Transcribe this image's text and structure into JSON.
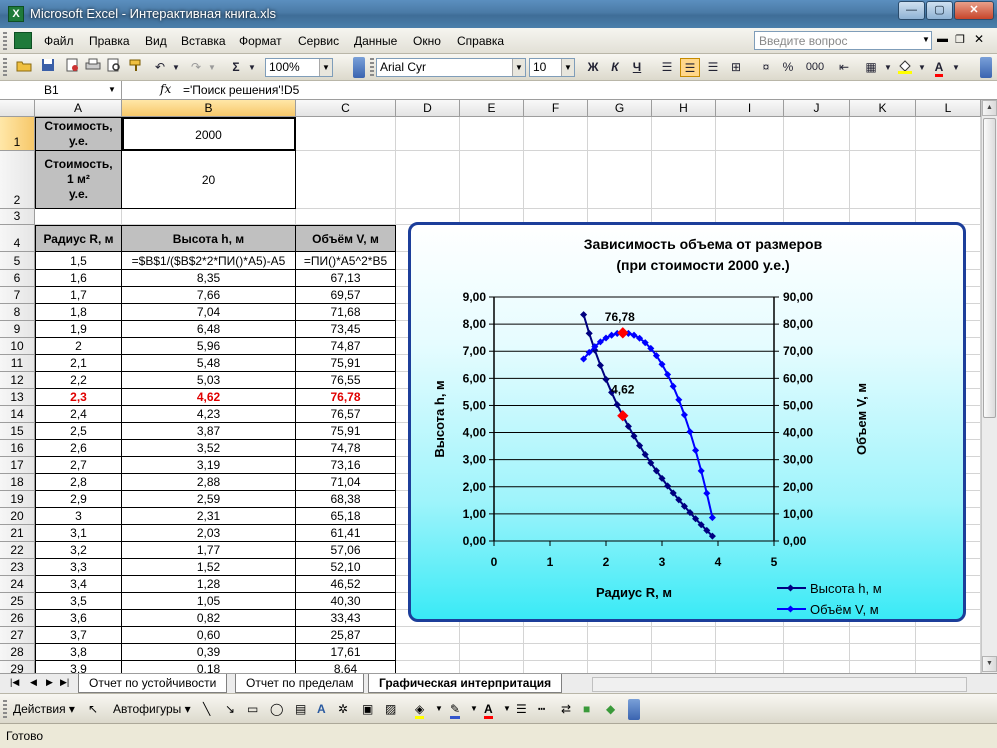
{
  "window": {
    "title": "Microsoft Excel - Интерактивная книга.xls",
    "app_icon": "X",
    "min": "—",
    "max": "▢",
    "close": "✕"
  },
  "menu": {
    "items": [
      "Файл",
      "Правка",
      "Вид",
      "Вставка",
      "Формат",
      "Сервис",
      "Данные",
      "Окно",
      "Справка"
    ],
    "help_placeholder": "Введите вопрос"
  },
  "toolbar": {
    "zoom": "100%",
    "font_name": "Arial Cyr",
    "font_size": "10",
    "bold": "Ж",
    "italic": "К",
    "underline": "Ч",
    "sum": "Σ",
    "percent": "%",
    "thousands": "000"
  },
  "formula_bar": {
    "name_box": "B1",
    "fx": "fx",
    "formula": "='Поиск решения'!D5"
  },
  "columns": [
    "A",
    "B",
    "C",
    "D",
    "E",
    "F",
    "G",
    "H",
    "I",
    "J",
    "K",
    "L"
  ],
  "rows": [
    "1",
    "2",
    "3",
    "4",
    "5",
    "6",
    "7",
    "8",
    "9",
    "10",
    "11",
    "12",
    "13",
    "14",
    "15",
    "16",
    "17",
    "18",
    "19",
    "20",
    "21",
    "22",
    "23",
    "24",
    "25",
    "26",
    "27",
    "28",
    "29"
  ],
  "sheet": {
    "a1": "Стоимость,\nу.е.",
    "b1": "2000",
    "a2": "Стоимость,\n1 м²\nу.е.",
    "b2": "20",
    "headers": [
      "Радиус R, м",
      "Высота h, м",
      "Объём V, м"
    ],
    "table": [
      [
        "1,5",
        "=$B$1/($B$2*2*ПИ()*A5)-A5",
        "=ПИ()*A5^2*B5"
      ],
      [
        "1,6",
        "8,35",
        "67,13"
      ],
      [
        "1,7",
        "7,66",
        "69,57"
      ],
      [
        "1,8",
        "7,04",
        "71,68"
      ],
      [
        "1,9",
        "6,48",
        "73,45"
      ],
      [
        "2",
        "5,96",
        "74,87"
      ],
      [
        "2,1",
        "5,48",
        "75,91"
      ],
      [
        "2,2",
        "5,03",
        "76,55"
      ],
      [
        "2,3",
        "4,62",
        "76,78"
      ],
      [
        "2,4",
        "4,23",
        "76,57"
      ],
      [
        "2,5",
        "3,87",
        "75,91"
      ],
      [
        "2,6",
        "3,52",
        "74,78"
      ],
      [
        "2,7",
        "3,19",
        "73,16"
      ],
      [
        "2,8",
        "2,88",
        "71,04"
      ],
      [
        "2,9",
        "2,59",
        "68,38"
      ],
      [
        "3",
        "2,31",
        "65,18"
      ],
      [
        "3,1",
        "2,03",
        "61,41"
      ],
      [
        "3,2",
        "1,77",
        "57,06"
      ],
      [
        "3,3",
        "1,52",
        "52,10"
      ],
      [
        "3,4",
        "1,28",
        "46,52"
      ],
      [
        "3,5",
        "1,05",
        "40,30"
      ],
      [
        "3,6",
        "0,82",
        "33,43"
      ],
      [
        "3,7",
        "0,60",
        "25,87"
      ],
      [
        "3,8",
        "0,39",
        "17,61"
      ],
      [
        "3,9",
        "0,18",
        "8,64"
      ]
    ],
    "highlight_row": 8
  },
  "tabs": {
    "nav": [
      "|◀",
      "◀",
      "▶",
      "▶|"
    ],
    "items": [
      "Отчет по устойчивости",
      "Отчет по пределам",
      "Графическая интерпритация"
    ],
    "active": 2
  },
  "drawing": {
    "actions": "Действия",
    "autoshapes": "Автофигуры"
  },
  "status": "Готово",
  "chart_data": {
    "type": "scatter",
    "title": "Зависимость объема от размеров\n(при стоимости 2000 у.е.)",
    "title_line1": "Зависимость объема от размеров",
    "title_line2": "(при стоимости 2000 у.е.)",
    "xlabel": "Радиус R, м",
    "ylabel": "Высота h, м",
    "y2label": "Объем V, м",
    "xlim": [
      0,
      5
    ],
    "ylim": [
      0,
      9
    ],
    "y2lim": [
      0,
      90
    ],
    "x_ticks": [
      "0",
      "1",
      "2",
      "3",
      "4",
      "5"
    ],
    "y_ticks": [
      "0,00",
      "1,00",
      "2,00",
      "3,00",
      "4,00",
      "5,00",
      "6,00",
      "7,00",
      "8,00",
      "9,00"
    ],
    "y2_ticks": [
      "0,00",
      "10,00",
      "20,00",
      "30,00",
      "40,00",
      "50,00",
      "60,00",
      "70,00",
      "80,00",
      "90,00"
    ],
    "grid": true,
    "legend_position": "bottom-right",
    "series": [
      {
        "name": "Высота h, м",
        "axis": "left",
        "color": "#000080",
        "x": [
          1.6,
          1.7,
          1.8,
          1.9,
          2.0,
          2.1,
          2.2,
          2.3,
          2.4,
          2.5,
          2.6,
          2.7,
          2.8,
          2.9,
          3.0,
          3.1,
          3.2,
          3.3,
          3.4,
          3.5,
          3.6,
          3.7,
          3.8,
          3.9
        ],
        "y": [
          8.35,
          7.66,
          7.04,
          6.48,
          5.96,
          5.48,
          5.03,
          4.62,
          4.23,
          3.87,
          3.52,
          3.19,
          2.88,
          2.59,
          2.31,
          2.03,
          1.77,
          1.52,
          1.28,
          1.05,
          0.82,
          0.6,
          0.39,
          0.18
        ]
      },
      {
        "name": "Объём V, м",
        "axis": "right",
        "color": "#0000ff",
        "x": [
          1.6,
          1.7,
          1.8,
          1.9,
          2.0,
          2.1,
          2.2,
          2.3,
          2.4,
          2.5,
          2.6,
          2.7,
          2.8,
          2.9,
          3.0,
          3.1,
          3.2,
          3.3,
          3.4,
          3.5,
          3.6,
          3.7,
          3.8,
          3.9
        ],
        "y": [
          67.13,
          69.57,
          71.68,
          73.45,
          74.87,
          75.91,
          76.55,
          76.78,
          76.57,
          75.91,
          74.78,
          73.16,
          71.04,
          68.38,
          65.18,
          61.41,
          57.06,
          52.1,
          46.52,
          40.3,
          33.43,
          25.87,
          17.61,
          8.64
        ]
      }
    ],
    "highlight_color": "#ff0000",
    "annotations": [
      {
        "text": "76,78",
        "x": 2.3,
        "y": 76.78,
        "axis": "right"
      },
      {
        "text": "4,62",
        "x": 2.3,
        "y": 4.62,
        "axis": "left"
      }
    ]
  }
}
